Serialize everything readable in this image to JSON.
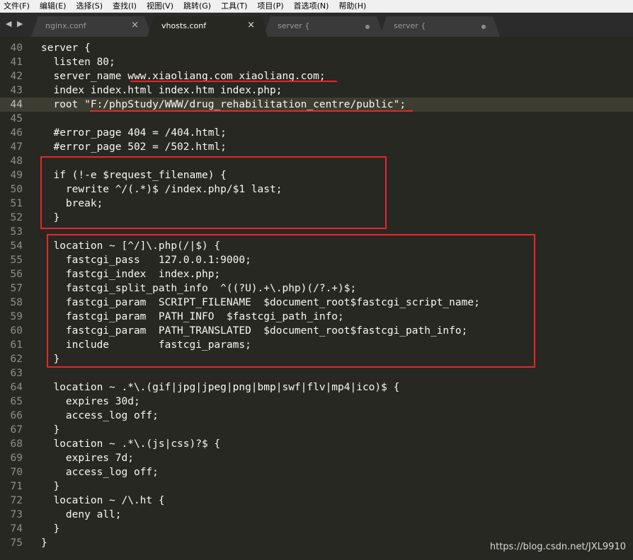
{
  "menu": [
    "文件(F)",
    "编辑(E)",
    "选择(S)",
    "查找(I)",
    "视图(V)",
    "跳转(G)",
    "工具(T)",
    "项目(P)",
    "首选项(N)",
    "帮助(H)"
  ],
  "nav_arrows": "◀ ▶",
  "tabs": [
    {
      "label": "nginx.conf",
      "active": false,
      "marker": "close"
    },
    {
      "label": "vhosts.conf",
      "active": true,
      "marker": "close"
    },
    {
      "label": "server {",
      "active": false,
      "marker": "dot"
    },
    {
      "label": "server {",
      "active": false,
      "marker": "dot"
    }
  ],
  "close_glyph": "×",
  "current_line": 44,
  "lines": [
    {
      "no": "40",
      "text": "server {"
    },
    {
      "no": "41",
      "text": "  listen 80;"
    },
    {
      "no": "42",
      "text": "  server_name www.xiaoliang.com xiaoliang.com;"
    },
    {
      "no": "43",
      "text": "  index index.html index.htm index.php;"
    },
    {
      "no": "44",
      "text": "  root \"F:/phpStudy/WWW/drug_rehabilitation_centre/public\";"
    },
    {
      "no": "45",
      "text": ""
    },
    {
      "no": "46",
      "text": "  #error_page 404 = /404.html;"
    },
    {
      "no": "47",
      "text": "  #error_page 502 = /502.html;"
    },
    {
      "no": "48",
      "text": ""
    },
    {
      "no": "49",
      "text": "  if (!-e $request_filename) {"
    },
    {
      "no": "50",
      "text": "    rewrite ^/(.*)$ /index.php/$1 last;"
    },
    {
      "no": "51",
      "text": "    break;"
    },
    {
      "no": "52",
      "text": "  }"
    },
    {
      "no": "53",
      "text": ""
    },
    {
      "no": "54",
      "text": "  location ~ [^/]\\.php(/|$) {"
    },
    {
      "no": "55",
      "text": "    fastcgi_pass   127.0.0.1:9000;"
    },
    {
      "no": "56",
      "text": "    fastcgi_index  index.php;"
    },
    {
      "no": "57",
      "text": "    fastcgi_split_path_info  ^((?U).+\\.php)(/?.+)$;"
    },
    {
      "no": "58",
      "text": "    fastcgi_param  SCRIPT_FILENAME  $document_root$fastcgi_script_name;"
    },
    {
      "no": "59",
      "text": "    fastcgi_param  PATH_INFO  $fastcgi_path_info;"
    },
    {
      "no": "60",
      "text": "    fastcgi_param  PATH_TRANSLATED  $document_root$fastcgi_path_info;"
    },
    {
      "no": "61",
      "text": "    include        fastcgi_params;"
    },
    {
      "no": "62",
      "text": "  }"
    },
    {
      "no": "63",
      "text": ""
    },
    {
      "no": "64",
      "text": "  location ~ .*\\.(gif|jpg|jpeg|png|bmp|swf|flv|mp4|ico)$ {"
    },
    {
      "no": "65",
      "text": "    expires 30d;"
    },
    {
      "no": "66",
      "text": "    access_log off;"
    },
    {
      "no": "67",
      "text": "  }"
    },
    {
      "no": "68",
      "text": "  location ~ .*\\.(js|css)?$ {"
    },
    {
      "no": "69",
      "text": "    expires 7d;"
    },
    {
      "no": "70",
      "text": "    access_log off;"
    },
    {
      "no": "71",
      "text": "  }"
    },
    {
      "no": "72",
      "text": "  location ~ /\\.ht {"
    },
    {
      "no": "73",
      "text": "    deny all;"
    },
    {
      "no": "74",
      "text": "  }"
    },
    {
      "no": "75",
      "text": "}"
    }
  ],
  "watermark": "https://blog.csdn.net/JXL9910",
  "colors": {
    "annotation_red": "#e8262a",
    "editor_bg": "#272822",
    "current_line_bg": "#3e3d32"
  }
}
